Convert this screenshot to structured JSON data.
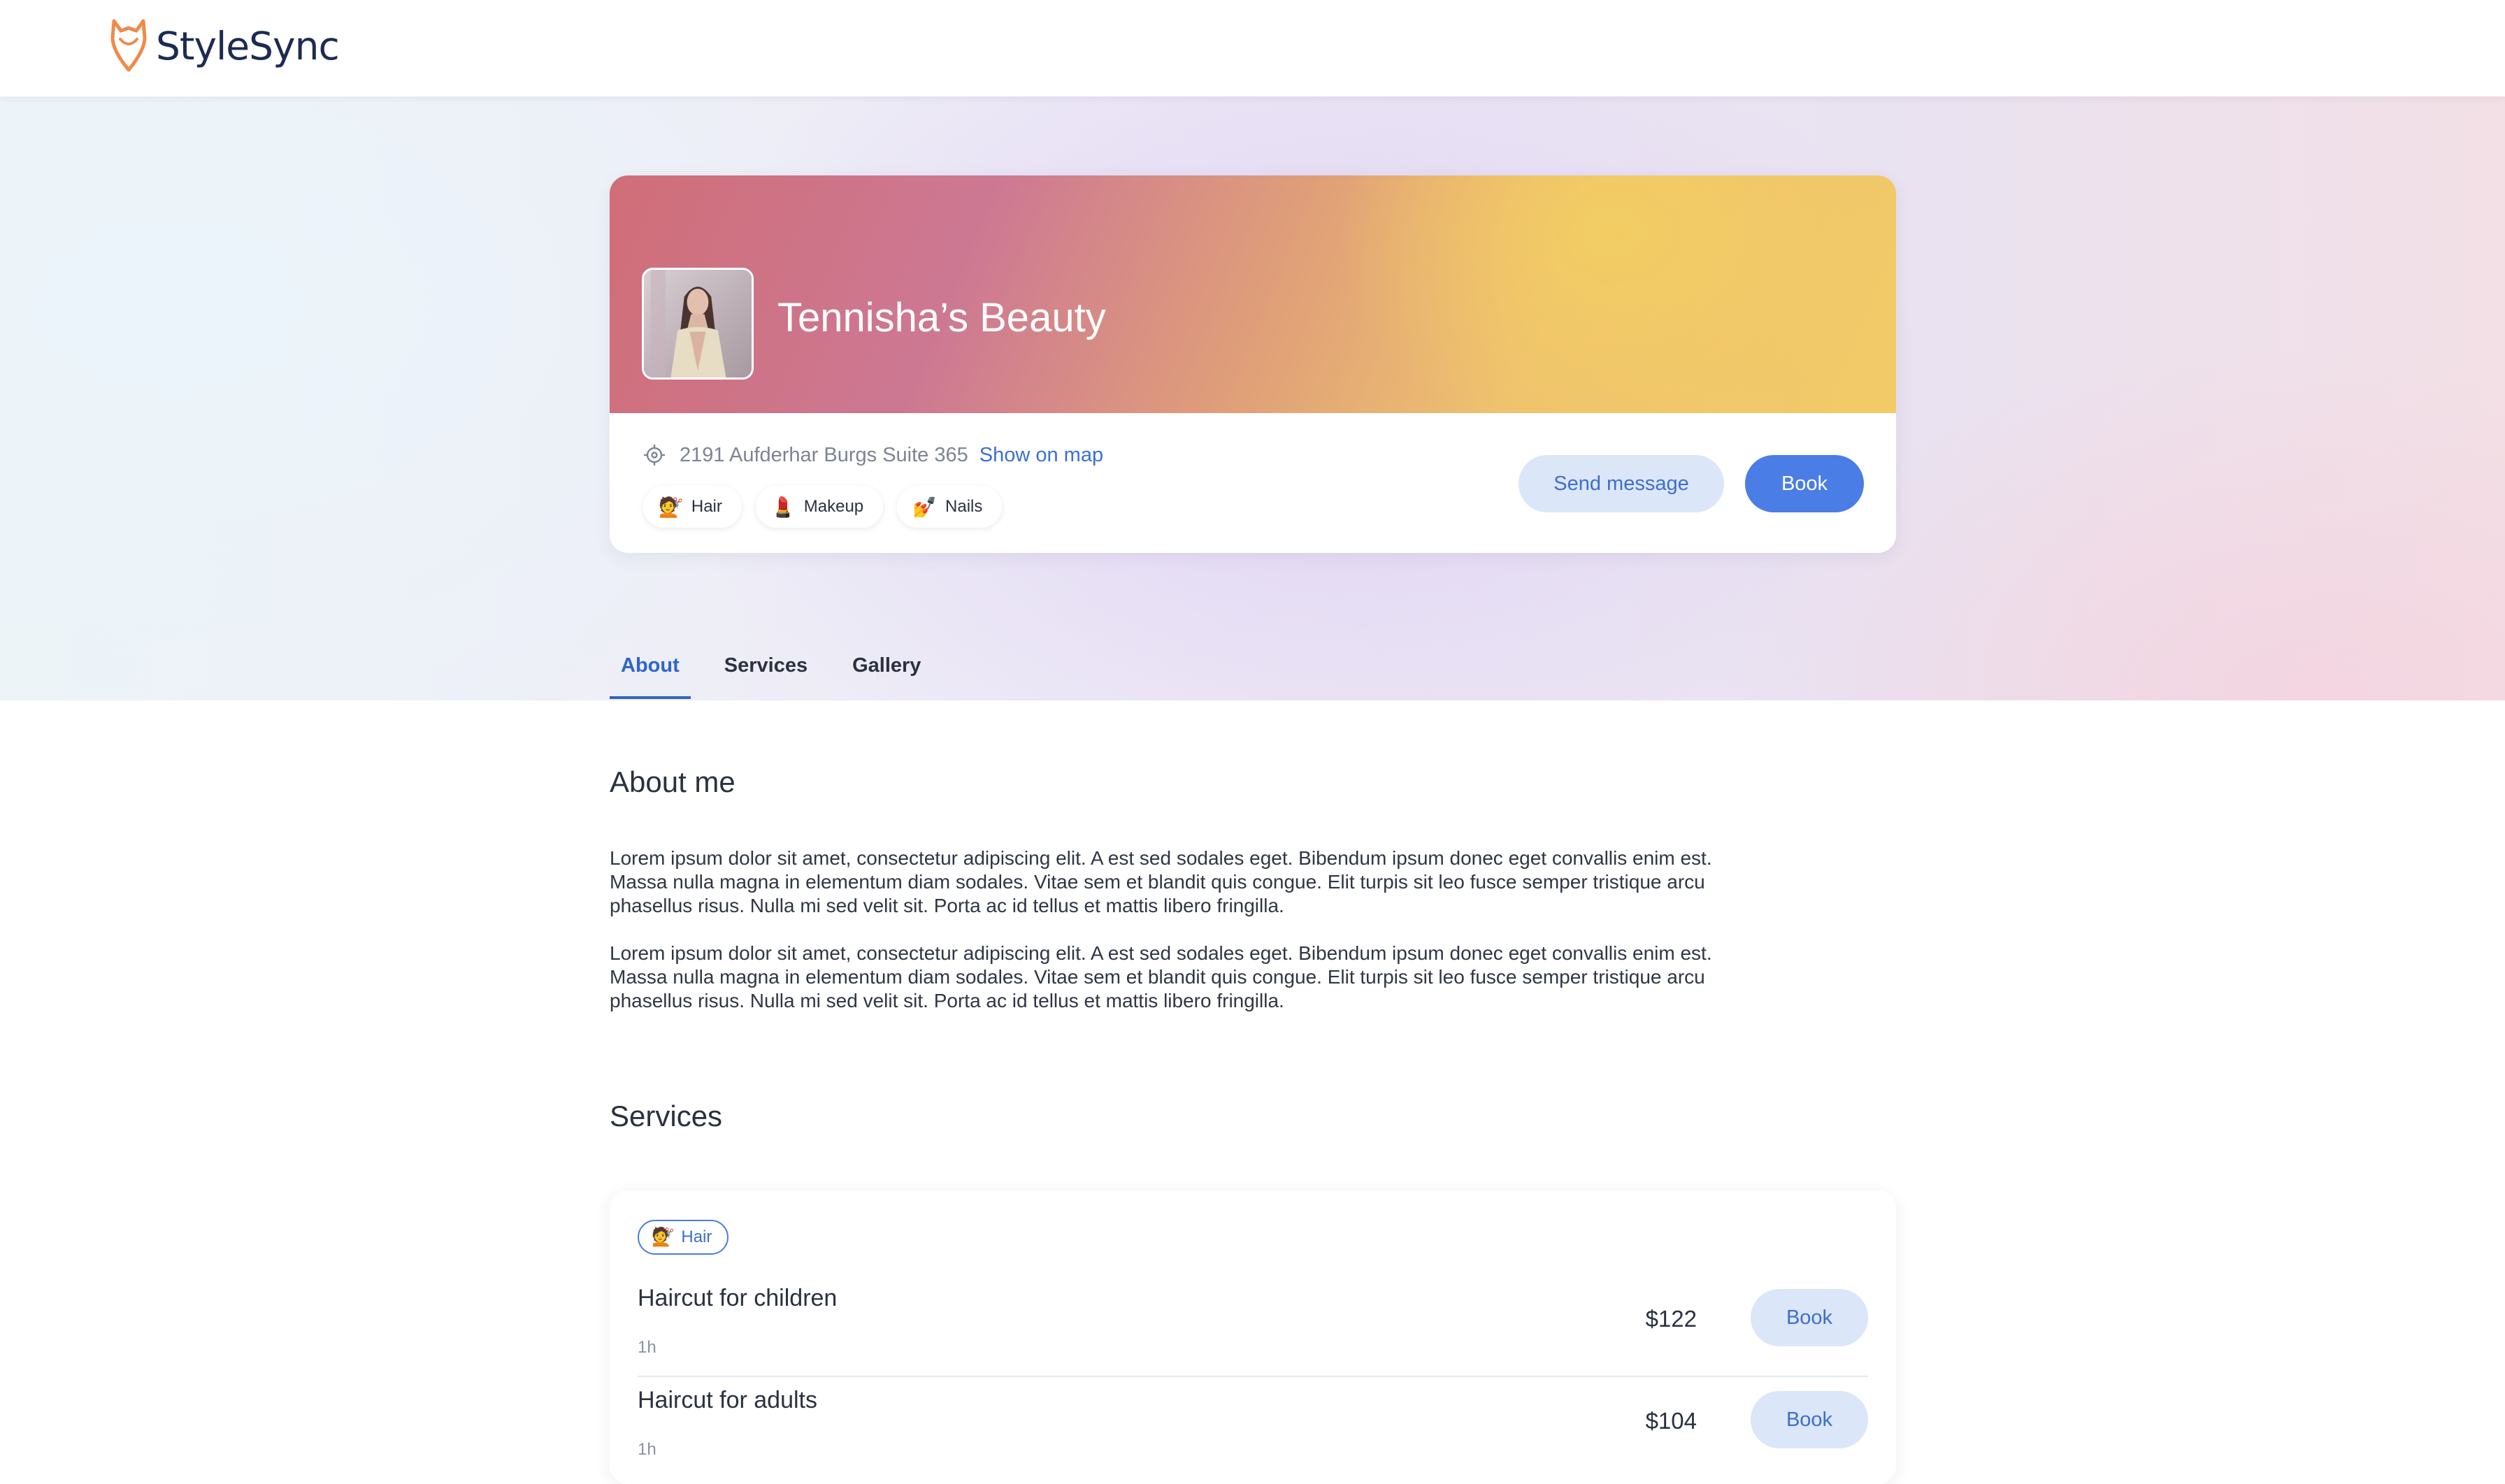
{
  "nav": {
    "logo_text": "StyleSync"
  },
  "profile": {
    "name": "Tennisha’s Beauty",
    "address": "2191 Aufderhar Burgs Suite 365",
    "show_map_label": "Show on map",
    "categories": [
      {
        "icon": "💇",
        "label": "Hair"
      },
      {
        "icon": "💄",
        "label": "Makeup"
      },
      {
        "icon": "💅",
        "label": "Nails"
      }
    ],
    "send_message_label": "Send message",
    "book_label": "Book"
  },
  "tabs": [
    {
      "label": "About",
      "active": true
    },
    {
      "label": "Services",
      "active": false
    },
    {
      "label": "Gallery",
      "active": false
    }
  ],
  "about": {
    "title": "About me",
    "paragraphs": [
      "Lorem ipsum dolor sit amet, consectetur adipiscing elit. A est sed sodales eget. Bibendum ipsum donec eget convallis enim est. Massa nulla magna in elementum diam sodales. Vitae sem et blandit quis congue. Elit turpis sit leo fusce semper tristique arcu phasellus risus. Nulla mi sed velit sit. Porta ac id tellus et mattis libero fringilla.",
      "Lorem ipsum dolor sit amet, consectetur adipiscing elit. A est sed sodales eget. Bibendum ipsum donec eget convallis enim est. Massa nulla magna in elementum diam sodales. Vitae sem et blandit quis congue. Elit turpis sit leo fusce semper tristique arcu phasellus risus. Nulla mi sed velit sit. Porta ac id tellus et mattis libero fringilla."
    ]
  },
  "services": {
    "title": "Services",
    "category": {
      "icon": "💇",
      "label": "Hair"
    },
    "items": [
      {
        "name": "Haircut for children",
        "duration": "1h",
        "price": "$122",
        "book_label": "Book"
      },
      {
        "name": "Haircut for adults",
        "duration": "1h",
        "price": "$104",
        "book_label": "Book"
      }
    ]
  },
  "colors": {
    "accent": "#4a7de5",
    "accent_soft": "#dbe6f9",
    "logo_orange": "#f08a4b"
  }
}
